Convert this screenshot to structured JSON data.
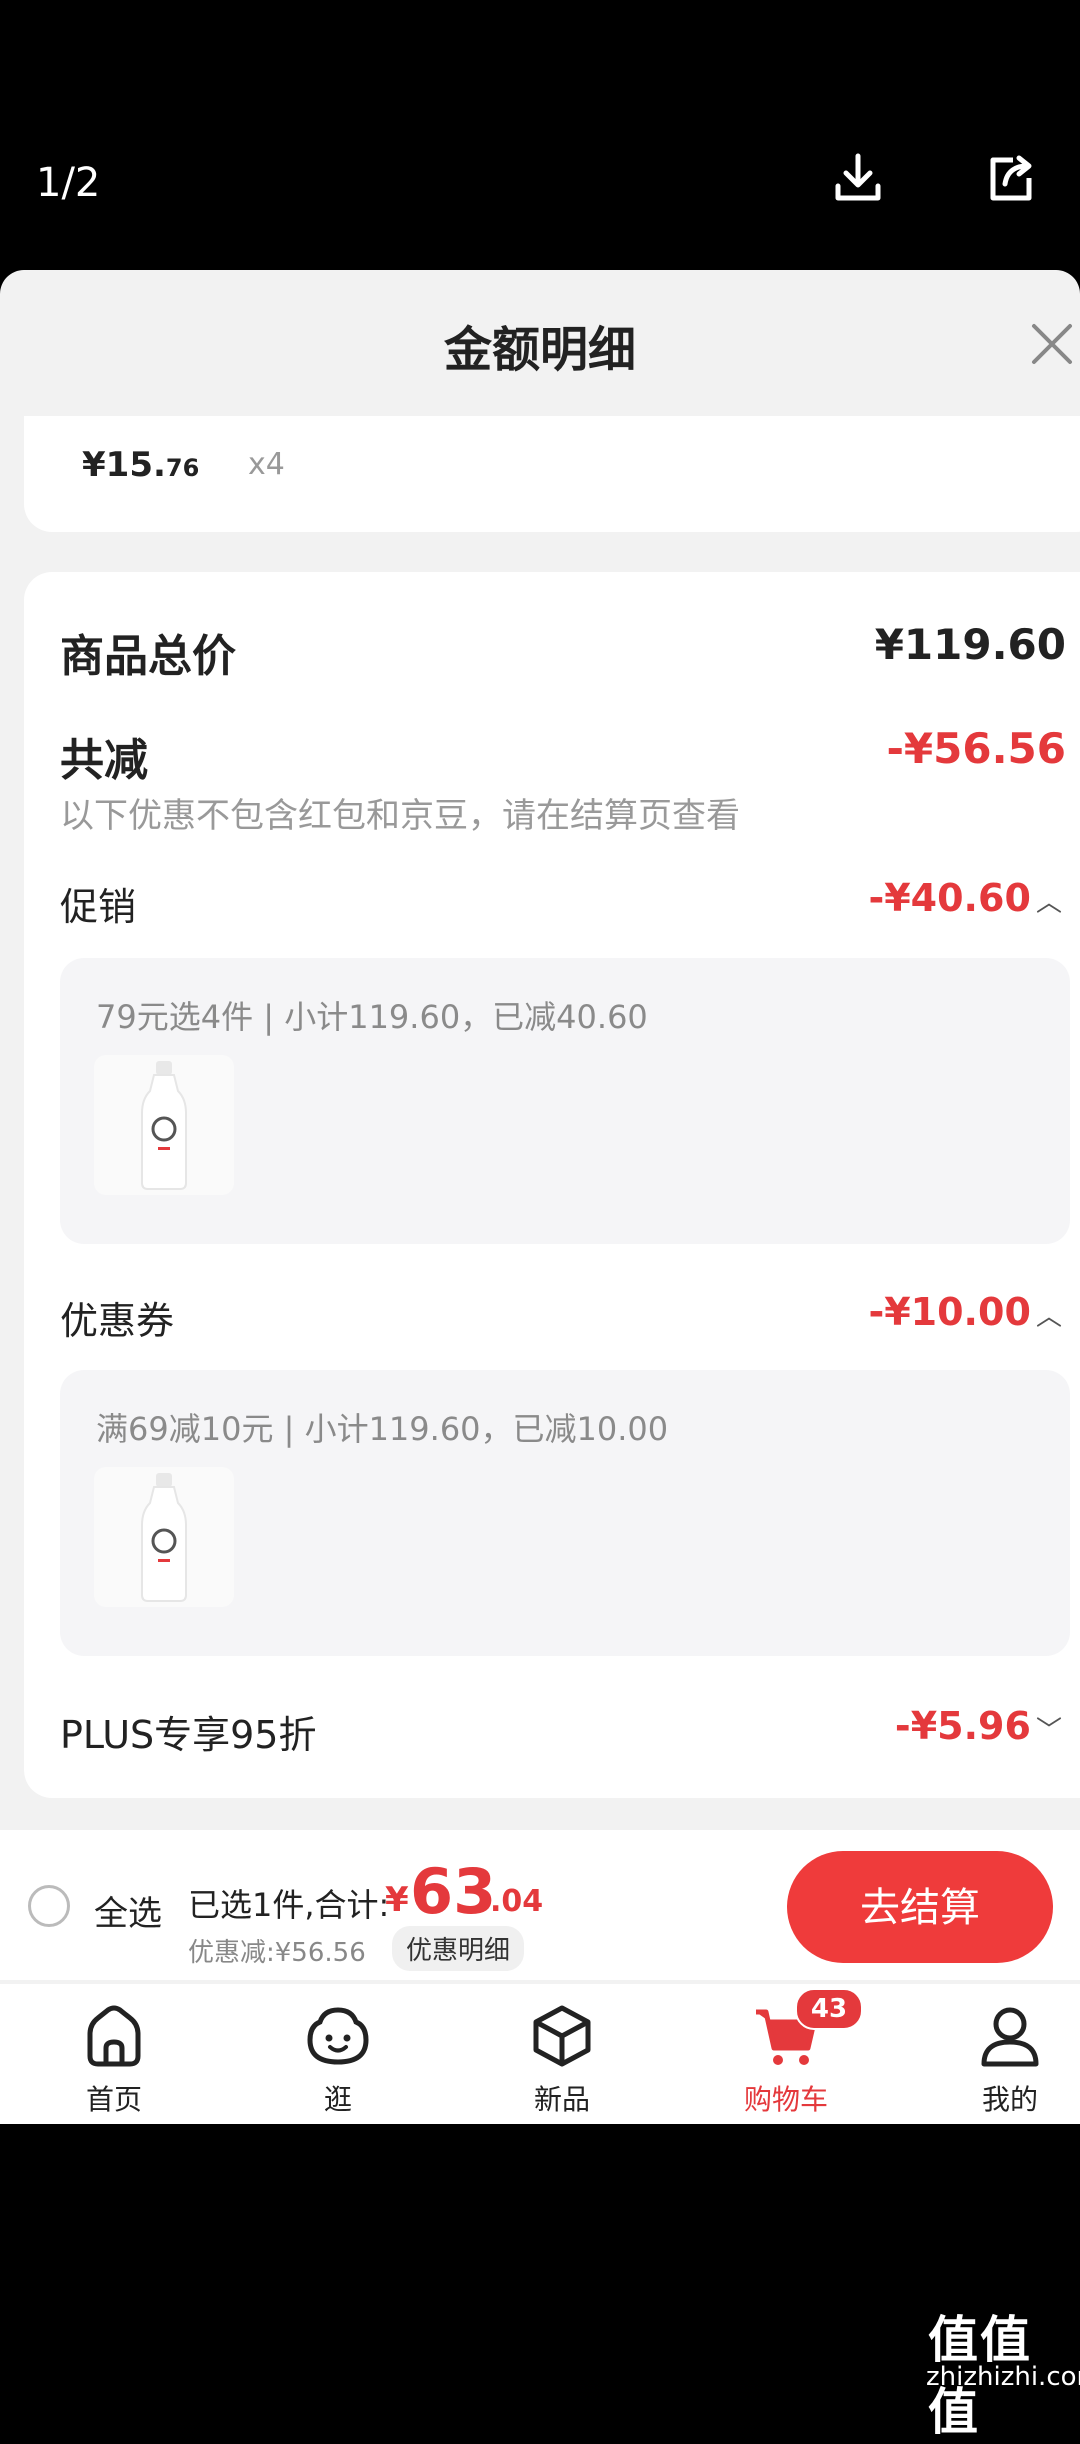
{
  "viewer": {
    "counter": "1/2"
  },
  "sheet": {
    "title": "金额明细"
  },
  "item_price": {
    "integer": "¥15.",
    "decimal": "76",
    "qty": "x4"
  },
  "summary": {
    "total_label": "商品总价",
    "total_value": "¥119.60",
    "reduce_label": "共减",
    "reduce_value": "-¥56.56",
    "reduce_note": "以下优惠不包含红包和京豆，请在结算页查看"
  },
  "promotion": {
    "label": "促销",
    "value": "-¥40.60",
    "detail": "79元选4件 | 小计119.60，已减40.60"
  },
  "coupon": {
    "label": "优惠券",
    "value": "-¥10.00",
    "detail": "满69减10元 | 小计119.60，已减10.00"
  },
  "plus": {
    "label": "PLUS专享95折",
    "value": "-¥5.96"
  },
  "checkout": {
    "select_all": "全选",
    "selected": "已选1件,合计:",
    "currency": "¥",
    "amount_int": "63",
    "amount_dec": ".04",
    "discount": "优惠减:¥56.56",
    "detail_tag": "优惠明细",
    "button": "去结算"
  },
  "tabs": [
    {
      "label": "首页",
      "icon": "home-icon"
    },
    {
      "label": "逛",
      "icon": "face-icon"
    },
    {
      "label": "新品",
      "icon": "box-icon"
    },
    {
      "label": "购物车",
      "icon": "cart-icon",
      "active": true,
      "badge": "43"
    },
    {
      "label": "我的",
      "icon": "user-icon"
    }
  ],
  "watermark": {
    "logo": "值值值",
    "url": "zhizhizhi.com"
  },
  "colors": {
    "accent": "#e4393c",
    "button": "#ef3b3b"
  }
}
